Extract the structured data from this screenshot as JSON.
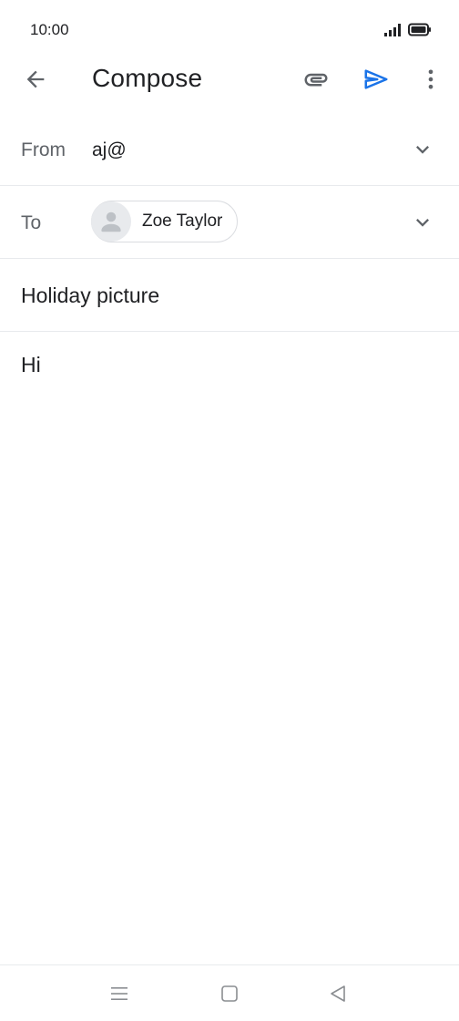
{
  "status_bar": {
    "time": "10:00",
    "icons": [
      "signal-icon",
      "battery-icon"
    ]
  },
  "app_bar": {
    "title": "Compose",
    "icons": [
      "arrow-back-icon",
      "paperclip-icon",
      "send-icon",
      "more-vert-icon"
    ]
  },
  "from": {
    "label": "From",
    "value": "aj@"
  },
  "to": {
    "label": "To",
    "recipients": [
      {
        "name": "Zoe Taylor"
      }
    ]
  },
  "subject": {
    "value": "Holiday picture"
  },
  "body": {
    "value": "Hi"
  },
  "nav_bar": {
    "icons": [
      "menu-icon",
      "home-square-icon",
      "back-triangle-icon"
    ]
  },
  "colors": {
    "accent": "#1a73e8",
    "icon_gray": "#5f6368",
    "text": "#202124",
    "divider": "#e8eaed"
  }
}
